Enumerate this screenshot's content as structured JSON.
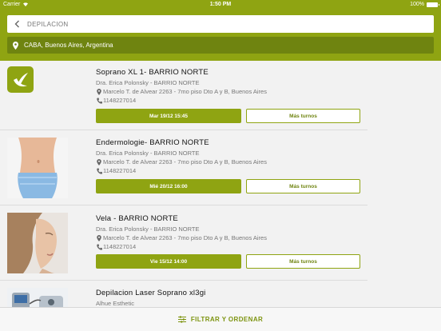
{
  "status_bar": {
    "carrier": "Carrier",
    "time": "1:50 PM",
    "battery": "100%"
  },
  "search": {
    "query": "DEPILACION"
  },
  "location": {
    "text": "CABA, Buenos Aires, Argentina"
  },
  "results": [
    {
      "title": "Soprano XL 1- BARRIO NORTE",
      "doctor": "Dra. Erica Polonsky - BARRIO NORTE",
      "address": "Marcelo T. de Alvear 2263 - 7mo piso Dto A y B, Buenos Aires",
      "phone": "1148227014",
      "next_slot": "Mar 19/12 15:45",
      "more_label": "Más turnos",
      "image": "app-logo"
    },
    {
      "title": "Endermologie- BARRIO NORTE",
      "doctor": "Dra. Erica Polonsky - BARRIO NORTE",
      "address": "Marcelo T. de Alvear 2263 - 7mo piso Dto A y B, Buenos Aires",
      "phone": "1148227014",
      "next_slot": "Mié 20/12 16:00",
      "more_label": "Más turnos",
      "image": "waist-photo"
    },
    {
      "title": "Vela - BARRIO NORTE",
      "doctor": "Dra. Erica Polonsky - BARRIO NORTE",
      "address": "Marcelo T. de Alvear 2263 - 7mo piso Dto A y B, Buenos Aires",
      "phone": "1148227014",
      "next_slot": "Vie 15/12 14:00",
      "more_label": "Más turnos",
      "image": "face-photo"
    },
    {
      "title": "Depilacion Laser Soprano xl3gi",
      "doctor": "Alhue Esthetic",
      "image": "device-photo"
    }
  ],
  "bottom_bar": {
    "filter_label": "FILTRAR Y ORDENAR"
  },
  "colors": {
    "brand_green": "#8fa412",
    "dark_green": "#6f8410"
  }
}
